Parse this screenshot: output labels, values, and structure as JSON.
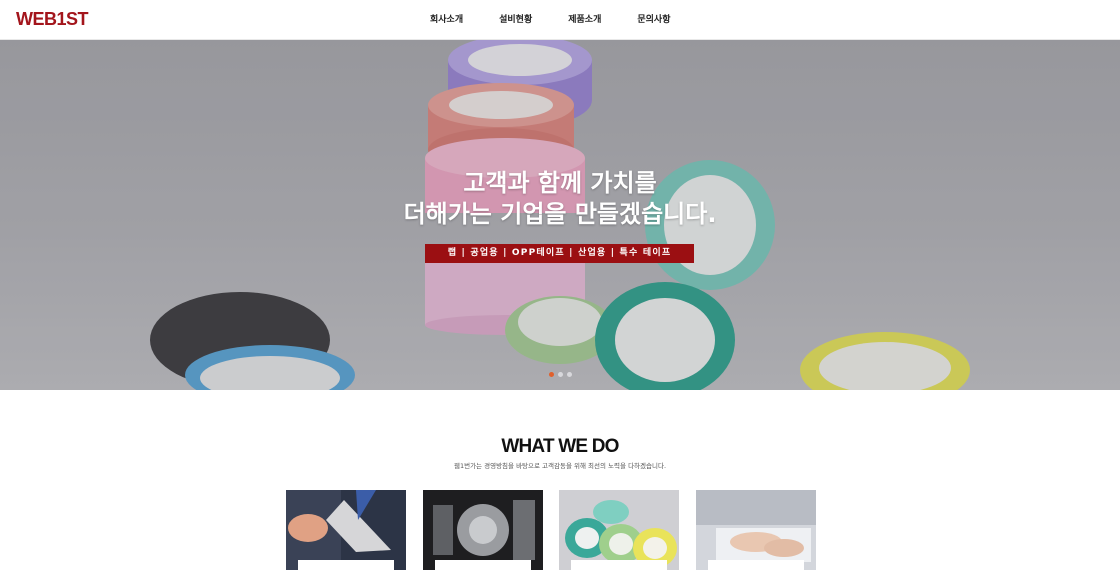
{
  "header": {
    "logo": "WEB1ST",
    "nav": [
      "회사소개",
      "설비현황",
      "제품소개",
      "문의사항"
    ]
  },
  "hero": {
    "title_line1": "고객과 함께 가치를",
    "title_line2": "더해가는 기업을 만들겠습니다.",
    "tags": "랩 | 공업용 | OPP테이프 | 산업용 | 특수 테이프",
    "slides_total": 3,
    "slide_active": 1
  },
  "section": {
    "title": "WHAT WE DO",
    "subtitle": "웹1번가는 경영방침을 바탕으로 고객감동을 위해 최선의 노력을 다하겠습니다."
  },
  "cards": [
    {
      "icon": "business-card-icon"
    },
    {
      "icon": "machinery-icon"
    },
    {
      "icon": "tape-rolls-icon"
    },
    {
      "icon": "keyboard-typing-icon"
    }
  ],
  "colors": {
    "brand": "#a3151c",
    "tag_bg": "#9b0f12",
    "dot_active": "#e0602c"
  }
}
